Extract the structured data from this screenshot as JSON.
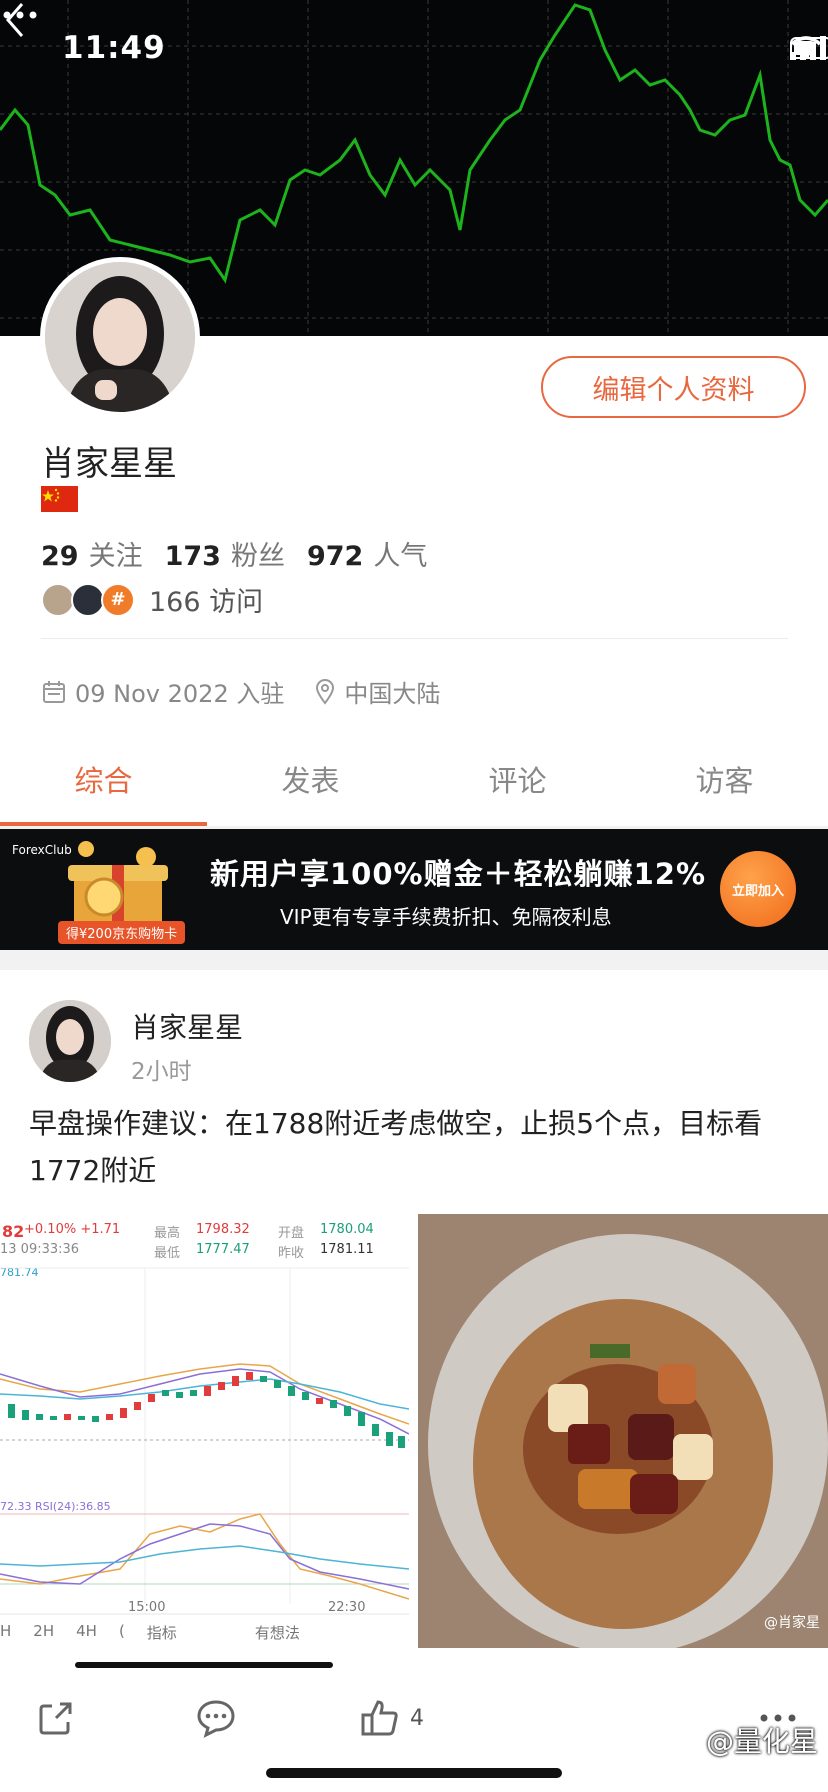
{
  "status_bar": {
    "time": "11:49"
  },
  "profile": {
    "edit_button": "编辑个人资料",
    "name": "肖家星星",
    "stats": [
      {
        "value": "29",
        "label": "关注"
      },
      {
        "value": "173",
        "label": "粉丝"
      },
      {
        "value": "972",
        "label": "人气"
      }
    ],
    "visits": "166 访问",
    "visitor_badge": "#",
    "join_date": "09 Nov 2022 入驻",
    "location": "中国大陆"
  },
  "tabs": [
    {
      "label": "综合",
      "active": true
    },
    {
      "label": "发表",
      "active": false
    },
    {
      "label": "评论",
      "active": false
    },
    {
      "label": "访客",
      "active": false
    }
  ],
  "ad": {
    "brand": "ForexClub",
    "title": "新用户享100%赠金＋轻松躺赚12%",
    "subtitle": "VIP更有专享手续费折扣、免隔夜利息",
    "gift_caption": "得¥200京东购物卡",
    "cta": "立即加入"
  },
  "post": {
    "author": "肖家星星",
    "time": "2小时",
    "text": "早盘操作建议：在1788附近考虑做空，止损5个点，目标看1772附近",
    "chart_header": {
      "price_fragment": "82",
      "change": "+0.10% +1.71",
      "datetime": "13 09:33:36",
      "high_label": "最高",
      "high": "1798.32",
      "low_label": "最低",
      "low": "1777.47",
      "open_label": "开盘",
      "open": "1780.04",
      "prev_label": "昨收",
      "prev": "1781.11",
      "ma_label": "781.74",
      "rsi_label": "72.33 RSI(24):36.85",
      "time_ticks": [
        "15:00",
        "22:30"
      ],
      "toolbar": [
        "H",
        "2H",
        "4H",
        "(",
        "指标",
        "有想法"
      ]
    },
    "photo_watermark": "@肖家星",
    "likes": "4"
  },
  "app_watermark": "@量化星",
  "colors": {
    "accent": "#e8683f",
    "chart_green": "#1db31d",
    "up": "#e23b3b",
    "down": "#1aa07a"
  }
}
